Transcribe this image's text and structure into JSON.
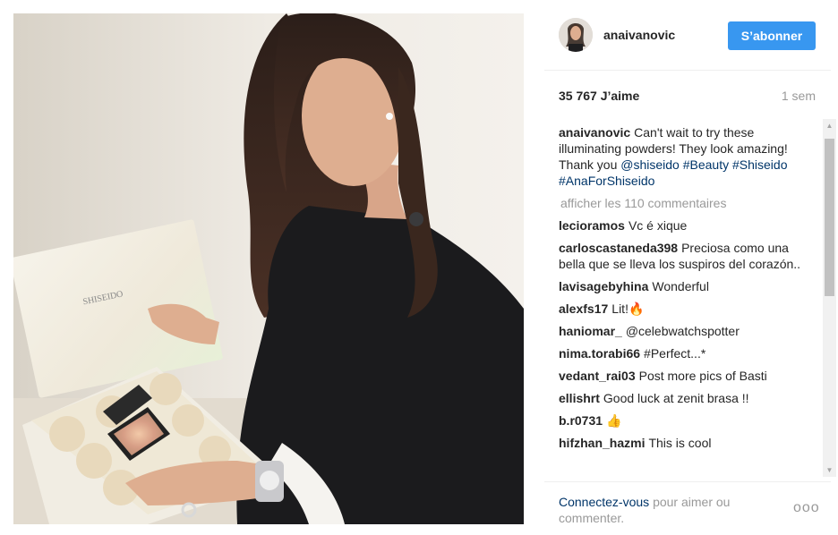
{
  "post": {
    "username": "anaivanovic",
    "follow_label": "S’abonner",
    "likes": "35 767 J’aime",
    "time": "1 sem",
    "caption": {
      "user": "anaivanovic",
      "text": "Can't wait to try these illuminating powders! They look amazing! Thank you",
      "mention": "@shiseido",
      "hashtags": [
        "#Beauty",
        "#Shiseido",
        "#AnaForShiseido"
      ]
    },
    "view_all": "afficher les 110 commentaires",
    "comments": [
      {
        "user": "lecioramos",
        "text": "Vc é xique"
      },
      {
        "user": "carloscastaneda398",
        "text": "Preciosa como una bella que se lleva los suspiros del corazón.."
      },
      {
        "user": "lavisagebyhina",
        "text": "Wonderful"
      },
      {
        "user": "alexfs17",
        "text": "Lit!🔥"
      },
      {
        "user": "haniomar_",
        "text": "@celebwatchspotter"
      },
      {
        "user": "nima.torabi66",
        "text": "#Perfect...*"
      },
      {
        "user": "vedant_rai03",
        "text": "Post more pics of Basti"
      },
      {
        "user": "ellishrt",
        "text": "Good luck at zenit brasa !!"
      },
      {
        "user": "b.r0731",
        "text": "👍"
      },
      {
        "user": "hifzhan_hazmi",
        "text": "This is cool"
      }
    ],
    "footer": {
      "login_link": "Connectez-vous",
      "login_rest": "pour aimer ou commenter.",
      "more": "ooo"
    },
    "photo_box_text": "SHISEIDO"
  },
  "colors": {
    "accent": "#3897f0",
    "link": "#003569",
    "muted": "#999999",
    "text": "#262626"
  },
  "icons": [
    "avatar",
    "more-options-icon",
    "scroll-up-icon",
    "scroll-down-icon"
  ]
}
